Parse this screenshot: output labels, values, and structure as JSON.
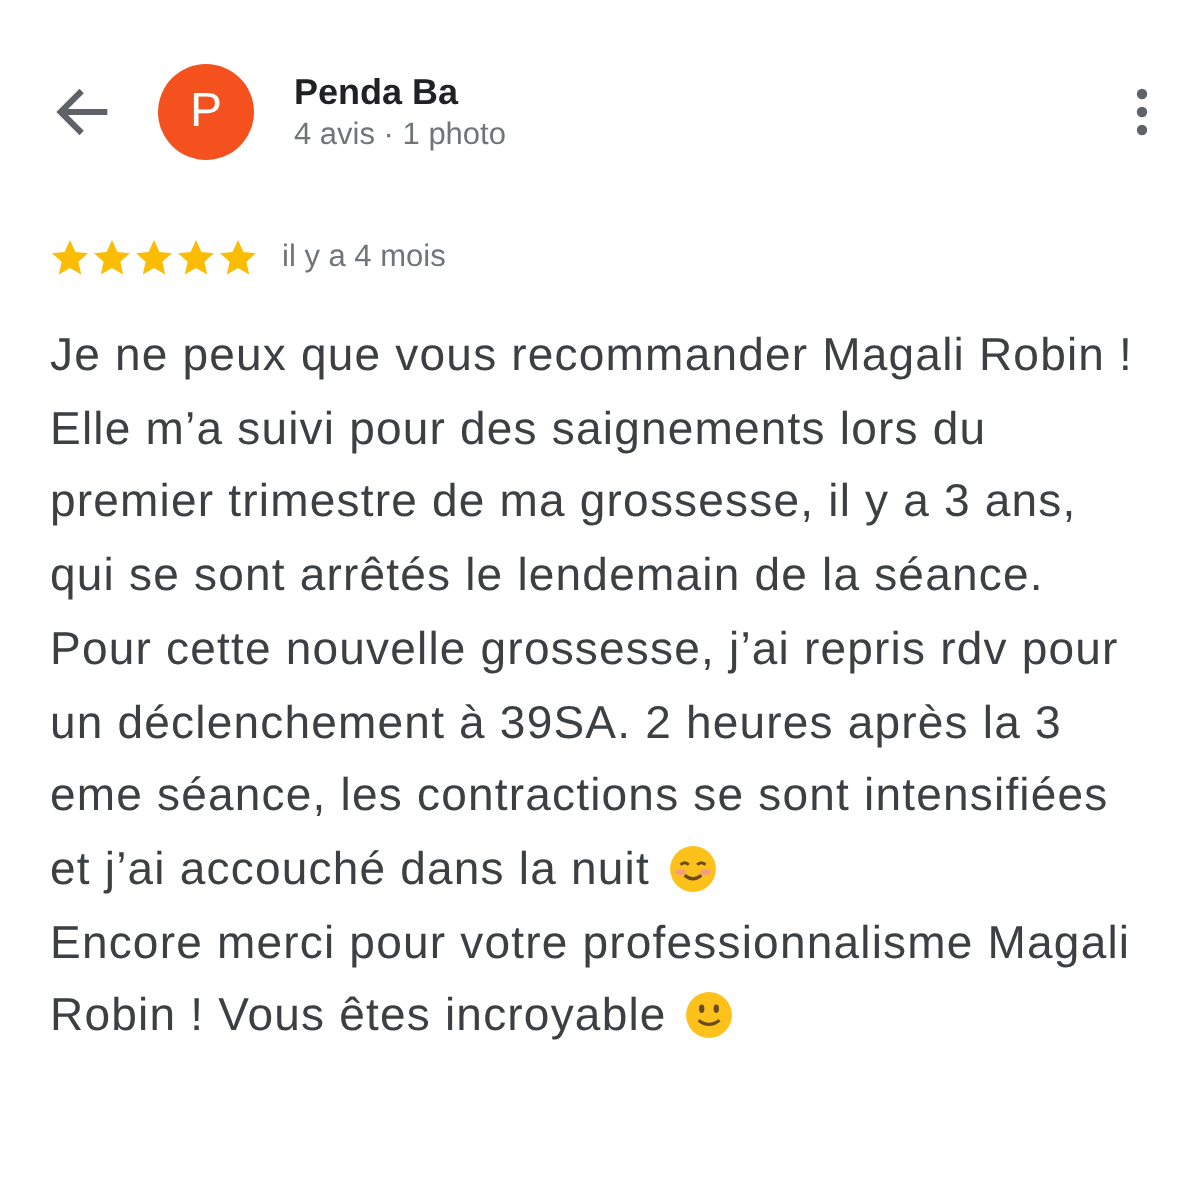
{
  "header": {
    "avatar_letter": "P",
    "name": "Penda Ba",
    "subtitle": "4 avis · 1 photo"
  },
  "review": {
    "stars": 5,
    "time": "il y a 4 mois",
    "paragraphs": [
      {
        "text": "Je ne peux que vous recommander Magali Robin !"
      },
      {
        "kind": "blush",
        "text": "Elle m’a suivi pour des saignements lors du premier trimestre de ma grossesse, il y a 3 ans, qui se sont arrêtés le lendemain de la séance. Pour cette nouvelle grossesse, j’ai repris rdv pour un déclenchement à 39SA. 2 heures après la 3 eme séance, les contractions se sont intensifiées",
        "tail": "et j’ai accouché dans la nuit"
      },
      {
        "kind": "smile",
        "text": "Encore merci pour votre professionnalisme Magali",
        "tail": "Robin ! Vous êtes incroyable"
      }
    ]
  }
}
